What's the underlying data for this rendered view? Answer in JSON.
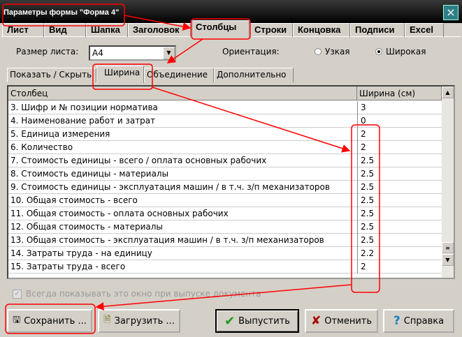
{
  "window": {
    "title": "Параметры формы \"Форма 4\"",
    "close_icon": "×"
  },
  "tabs": [
    "Лист",
    "Вид",
    "Шапка",
    "Заголовок",
    "Столбцы",
    "Строки",
    "Концовка",
    "Подписи",
    "Excel"
  ],
  "active_tab": "Столбцы",
  "sheet_size": {
    "label": "Размер листа:",
    "value": "A4"
  },
  "orientation": {
    "label": "Ориентация:",
    "options": [
      "Узкая",
      "Широкая"
    ],
    "selected": "Широкая"
  },
  "subtabs": [
    "Показать / Скрыть",
    "Ширина",
    "Объединение",
    "Дополнительно"
  ],
  "active_subtab": "Ширина",
  "grid": {
    "headers": [
      "Столбец",
      "Ширина (см)"
    ],
    "rows": [
      {
        "name": "3.  Шифр и № позиции норматива",
        "width": "3"
      },
      {
        "name": "4.  Наименование работ и затрат",
        "width": "0"
      },
      {
        "name": "5.  Единица измерения",
        "width": "2"
      },
      {
        "name": "6.  Количество",
        "width": "2"
      },
      {
        "name": "7.  Стоимость единицы - всего / оплата основных рабочих",
        "width": "2.5"
      },
      {
        "name": "8.  Стоимость единицы - материалы",
        "width": "2.5"
      },
      {
        "name": "9.  Стоимость единицы - эксплуатация машин / в т.ч. з/п механизаторов",
        "width": "2.5"
      },
      {
        "name": "10.  Общая стоимость - всего",
        "width": "2.5"
      },
      {
        "name": "11.  Общая стоимость - оплата основных рабочих",
        "width": "2.5"
      },
      {
        "name": "12.  Общая стоимость - материалы",
        "width": "2.5"
      },
      {
        "name": "13.  Общая стоимость - эксплуатация машин / в т.ч. з/п механизаторов",
        "width": "2.5"
      },
      {
        "name": "14.  Затраты труда - на единицу",
        "width": "2.2"
      },
      {
        "name": "15.  Затраты труда - всего",
        "width": "2"
      }
    ]
  },
  "always_show": {
    "label": "Всегда показывать это окно при выпуске документа",
    "checked": true
  },
  "buttons": {
    "save": "Сохранить ...",
    "load": "Загрузить ...",
    "issue": "Выпустить",
    "cancel": "Отменить",
    "help": "Справка"
  }
}
